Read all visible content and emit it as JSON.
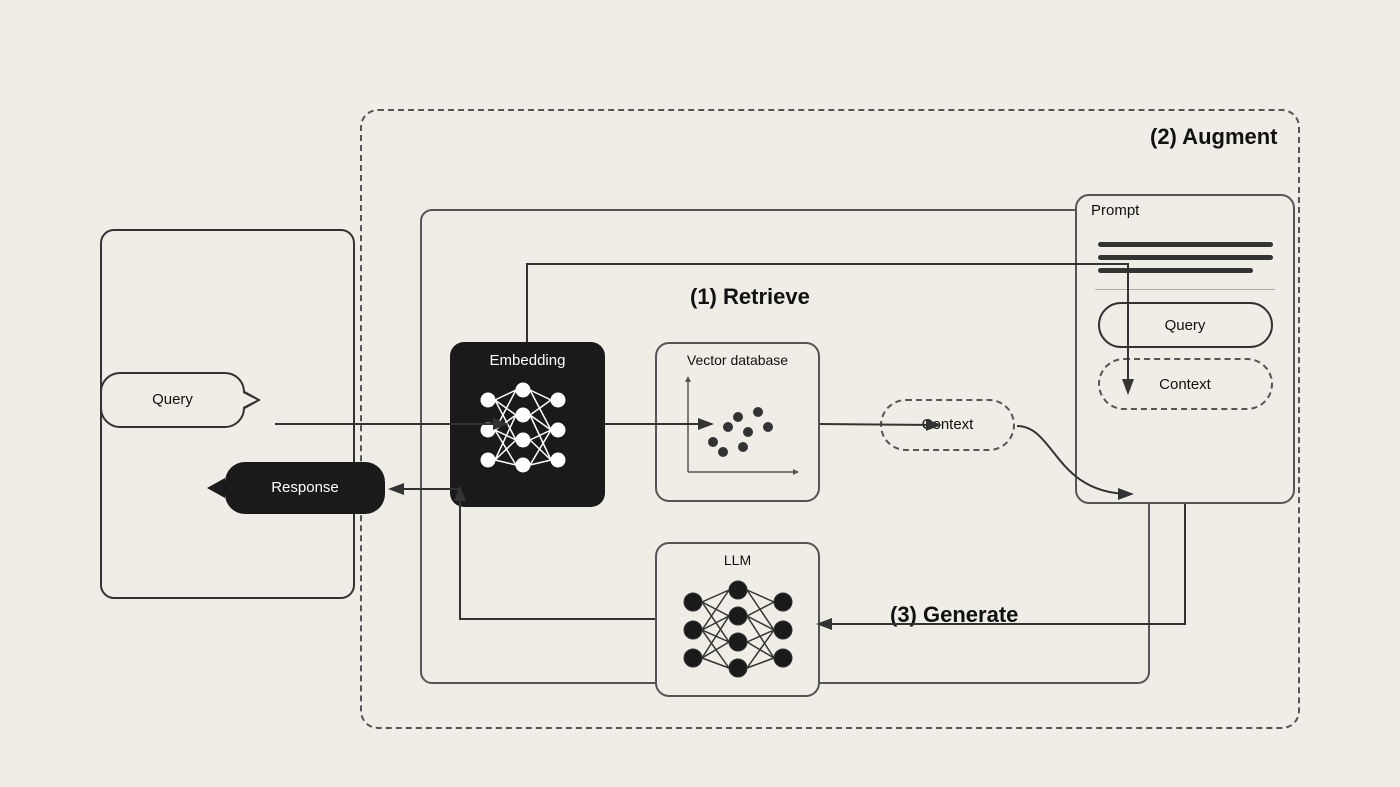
{
  "labels": {
    "query": "Query",
    "response": "Response",
    "embedding": "Embedding",
    "vector_db": "Vector database",
    "llm": "LLM",
    "context": "Context",
    "prompt": "Prompt",
    "retrieve": "(1) Retrieve",
    "augment": "(2) Augment",
    "generate": "(3) Generate"
  },
  "colors": {
    "background": "#f0ede6",
    "dark": "#1a1a1a",
    "border": "#555",
    "text_dark": "#111",
    "text_white": "#ffffff"
  }
}
